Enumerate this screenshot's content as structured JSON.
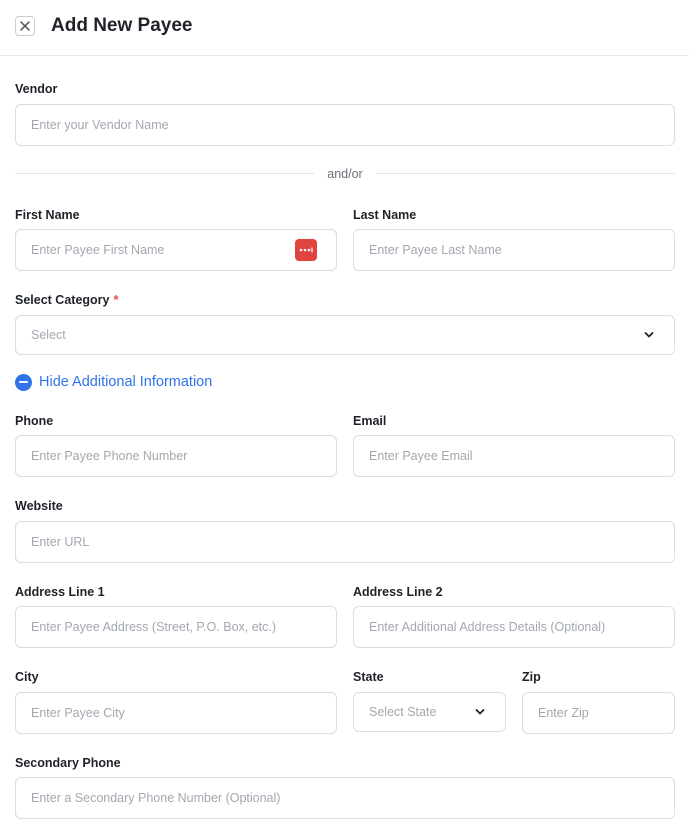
{
  "header": {
    "title": "Add New Payee",
    "close_icon": "close-icon"
  },
  "vendor": {
    "label": "Vendor",
    "placeholder": "Enter your Vendor Name"
  },
  "divider": {
    "text": "and/or"
  },
  "first_name": {
    "label": "First Name",
    "placeholder": "Enter Payee First Name",
    "password_manager_icon": "password-manager-icon",
    "icon_color": "#e0443e"
  },
  "last_name": {
    "label": "Last Name",
    "placeholder": "Enter Payee Last Name"
  },
  "category": {
    "label": "Select Category",
    "required_mark": "*",
    "placeholder": "Select"
  },
  "toggle": {
    "label": "Hide Additional Information",
    "icon": "minus-circle-icon",
    "color": "#2f74e8"
  },
  "phone": {
    "label": "Phone",
    "placeholder": "Enter Payee Phone Number"
  },
  "email": {
    "label": "Email",
    "placeholder": "Enter Payee Email"
  },
  "website": {
    "label": "Website",
    "placeholder": "Enter URL"
  },
  "address1": {
    "label": "Address Line 1",
    "placeholder": "Enter Payee Address (Street, P.O. Box, etc.)"
  },
  "address2": {
    "label": "Address Line 2",
    "placeholder": "Enter Additional Address Details (Optional)"
  },
  "city": {
    "label": "City",
    "placeholder": "Enter Payee City"
  },
  "state": {
    "label": "State",
    "placeholder": "Select State"
  },
  "zip": {
    "label": "Zip",
    "placeholder": "Enter Zip"
  },
  "secondary_phone": {
    "label": "Secondary Phone",
    "placeholder": "Enter a Secondary Phone Number (Optional)"
  }
}
